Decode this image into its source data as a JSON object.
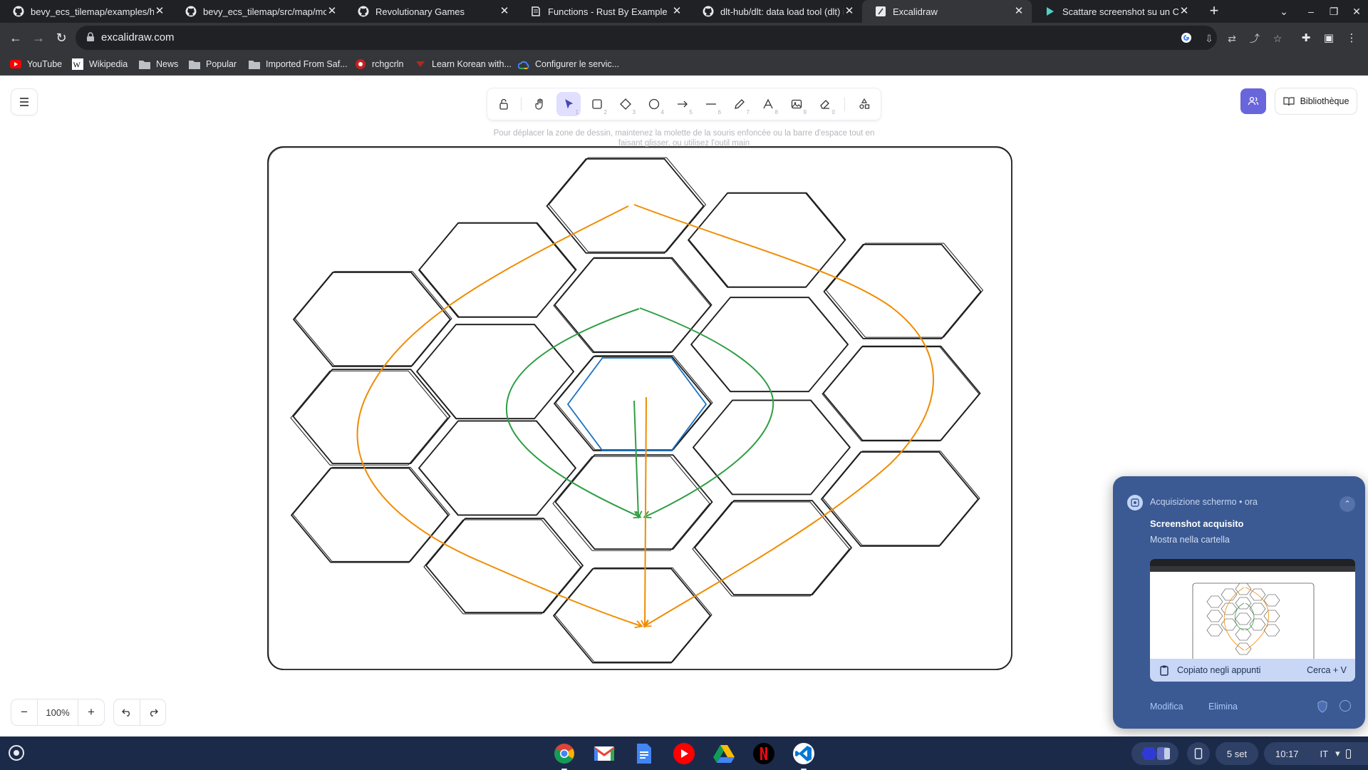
{
  "browser": {
    "tabs": [
      {
        "title": "bevy_ecs_tilemap/examples/hexagon_row.rs",
        "icon": "github-icon",
        "active": false
      },
      {
        "title": "bevy_ecs_tilemap/src/map/mod.rs",
        "icon": "github-icon",
        "active": false
      },
      {
        "title": "Revolutionary Games",
        "icon": "github-icon",
        "active": false
      },
      {
        "title": "Functions - Rust By Example",
        "icon": "book-icon",
        "active": false
      },
      {
        "title": "dlt-hub/dlt: data load tool (dlt) is",
        "icon": "github-icon",
        "active": false
      },
      {
        "title": "Excalidraw",
        "icon": "excalidraw-icon",
        "active": true
      },
      {
        "title": "Scattare screenshot su un Chrom",
        "icon": "chromebook-help-icon",
        "active": false
      }
    ],
    "url": "excalidraw.com",
    "bookmarks": [
      {
        "label": "YouTube",
        "icon": "youtube-icon"
      },
      {
        "label": "Wikipedia",
        "icon": "wikipedia-icon"
      },
      {
        "label": "News",
        "icon": "folder-icon"
      },
      {
        "label": "Popular",
        "icon": "folder-icon"
      },
      {
        "label": "Imported From Saf...",
        "icon": "folder-icon"
      },
      {
        "label": "rchgcrln",
        "icon": "site-icon"
      },
      {
        "label": "Learn Korean with...",
        "icon": "site-icon"
      },
      {
        "label": "Configurer le servic...",
        "icon": "google-cloud-icon"
      }
    ]
  },
  "excalidraw": {
    "tools": [
      {
        "name": "lock",
        "key": ""
      },
      {
        "name": "hand",
        "key": ""
      },
      {
        "name": "selection",
        "key": "1",
        "selected": true
      },
      {
        "name": "rectangle",
        "key": "2"
      },
      {
        "name": "diamond",
        "key": "3"
      },
      {
        "name": "ellipse",
        "key": "4"
      },
      {
        "name": "arrow",
        "key": "5"
      },
      {
        "name": "line",
        "key": "6"
      },
      {
        "name": "draw",
        "key": "7"
      },
      {
        "name": "text",
        "key": "8"
      },
      {
        "name": "image",
        "key": "9"
      },
      {
        "name": "eraser",
        "key": "0"
      },
      {
        "name": "extra-tools",
        "key": ""
      }
    ],
    "hint": "Pour déplacer la zone de dessin, maintenez la molette de la souris enfoncée ou la barre d'espace tout en faisant glisser, ou utilisez l'outil main",
    "library_label": "Bibliothèque",
    "zoom_value": "100%",
    "colors": {
      "accent": "#6965db",
      "orange": "#f08c00",
      "green": "#2f9e44",
      "blue": "#1971c2",
      "stroke": "#1e1e1e"
    }
  },
  "notification": {
    "source": "Acquisizione schermo • ora",
    "title": "Screenshot acquisito",
    "subtitle": "Mostra nella cartella",
    "copied_label": "Copiato negli appunti",
    "shortcut": "Cerca + V",
    "actions": [
      "Modifica",
      "Elimina"
    ]
  },
  "shelf": {
    "apps": [
      "chrome-icon",
      "gmail-icon",
      "docs-icon",
      "youtube-icon",
      "drive-icon",
      "netflix-icon",
      "vscode-icon"
    ],
    "date": "5 set",
    "time": "10:17",
    "locale": "IT"
  }
}
